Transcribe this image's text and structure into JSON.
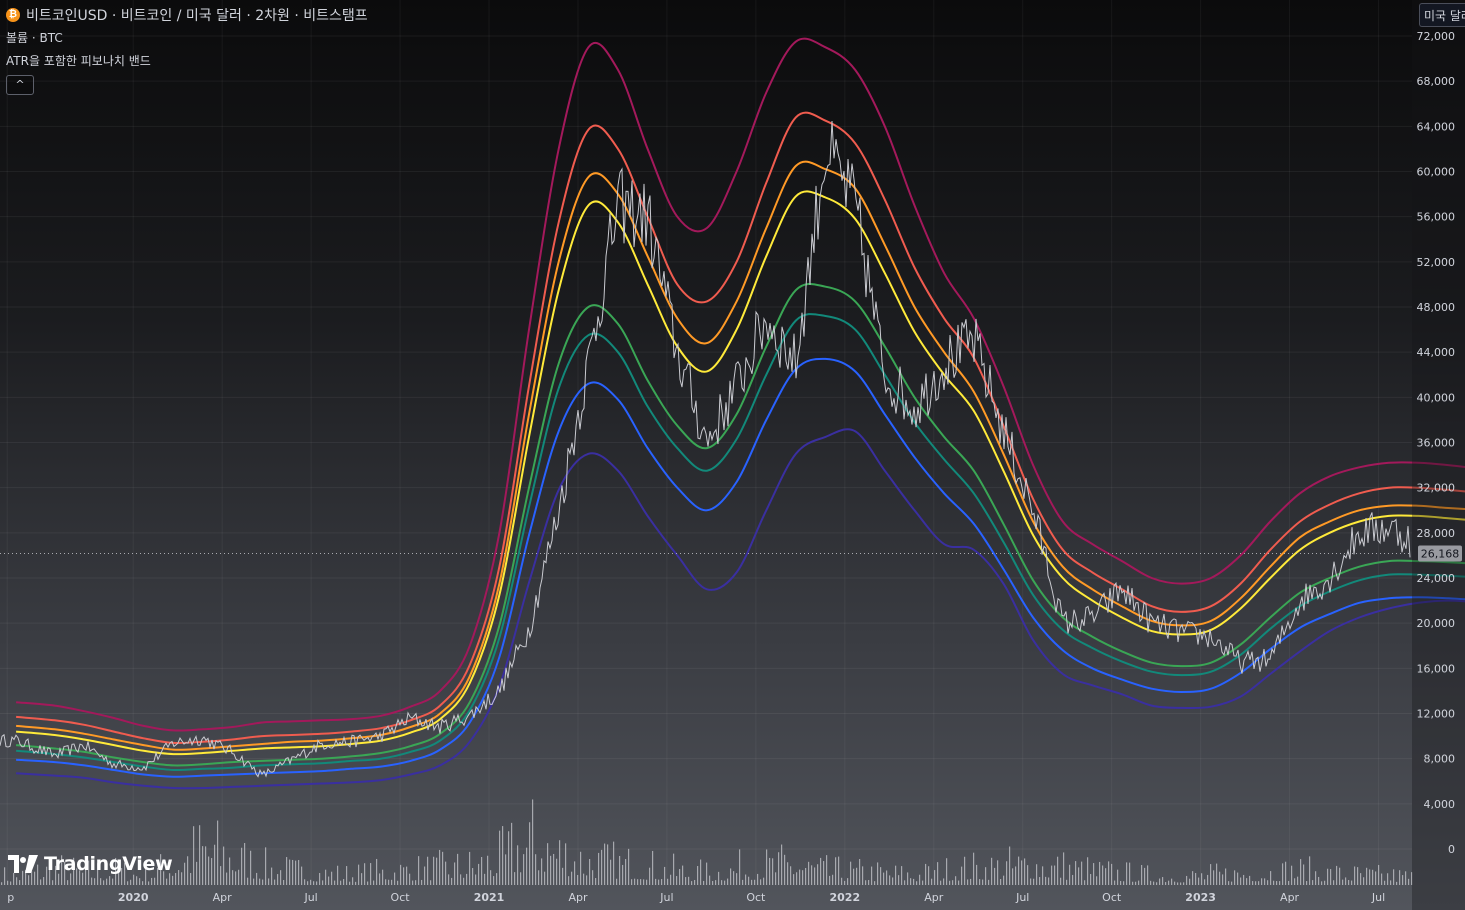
{
  "header": {
    "symbol_title": "비트코인USD · 비트코인 / 미국 달러 · 2차원 · 비트스탬프",
    "volume_label": "볼륨 · BTC",
    "indicator_label": "ATR을 포함한 피보나치 밴드",
    "collapse_icon": "chevron-up-icon"
  },
  "currency_button": {
    "label": "미국 달러"
  },
  "brand": {
    "name": "TradingView"
  },
  "colors": {
    "price": "#c9cad0",
    "volume": "#c5c7cc",
    "bands": [
      "#a3195b",
      "#f05c4f",
      "#ff9a26",
      "#ffea3a",
      "#3aa655",
      "#12897a",
      "#2962ff",
      "#3a2fa0"
    ]
  },
  "chart_data": {
    "type": "line",
    "x_ticks": [
      "p",
      "2020",
      "Apr",
      "Jul",
      "Oct",
      "2021",
      "Apr",
      "Jul",
      "Oct",
      "2022",
      "Apr",
      "Jul",
      "Oct",
      "2023",
      "Apr",
      "Jul"
    ],
    "y_ticks": [
      "72,000",
      "68,000",
      "64,000",
      "60,000",
      "56,000",
      "52,000",
      "48,000",
      "44,000",
      "40,000",
      "36,000",
      "32,000",
      "28,000",
      "24,000",
      "20,000",
      "16,000",
      "12,000",
      "8,000",
      "4,000",
      "0"
    ],
    "ylim": [
      0,
      72000
    ],
    "last_price": 26168,
    "last_price_label": "26,168",
    "x_months_from_sep_2019": [
      -0.3,
      1,
      2,
      3,
      4,
      5,
      6,
      7,
      8,
      9,
      10,
      11,
      12,
      13,
      14,
      15,
      16,
      17,
      18,
      19,
      20,
      21,
      22,
      23,
      24,
      25,
      26,
      27,
      28,
      29,
      30,
      31,
      32,
      33,
      34,
      35,
      36,
      37,
      38,
      39,
      40,
      41,
      42,
      43,
      44,
      45,
      46,
      47,
      48,
      49.3
    ],
    "series": [
      {
        "values": [
          9600,
          8300,
          9200,
          7500,
          7200,
          9400,
          9800,
          8600,
          6500,
          7900,
          9300,
          9500,
          10000,
          11600,
          10800,
          11800,
          14000,
          19500,
          30000,
          43000,
          57000,
          56000,
          44000,
          36000,
          41000,
          47000,
          43000,
          62000,
          57000,
          42000,
          39000,
          43000,
          45000,
          37000,
          30000,
          20000,
          20500,
          23000,
          20000,
          19200,
          18800,
          16500,
          16800,
          22000,
          24000,
          28000,
          28500,
          27000,
          30500,
          26168
        ]
      },
      {
        "values": [
          13000,
          12700,
          12200,
          11600,
          10900,
          10500,
          10600,
          10800,
          11200,
          11300,
          11400,
          11500,
          11800,
          12600,
          14000,
          18000,
          28000,
          46000,
          62000,
          71000,
          69000,
          62000,
          56000,
          55000,
          60000,
          67000,
          71500,
          71000,
          69000,
          64000,
          57000,
          51000,
          47000,
          41000,
          34000,
          29000,
          27000,
          25500,
          24000,
          23500,
          24000,
          26000,
          29000,
          31500,
          33000,
          33800,
          34200,
          34200,
          34000,
          33600
        ]
      },
      {
        "values": [
          11700,
          11400,
          11000,
          10400,
          9800,
          9400,
          9500,
          9700,
          10000,
          10100,
          10200,
          10400,
          10700,
          11400,
          12700,
          16300,
          25000,
          41000,
          55500,
          63700,
          62000,
          56000,
          50000,
          48500,
          52000,
          59000,
          64800,
          64500,
          62500,
          57500,
          51500,
          47000,
          43500,
          37500,
          31000,
          26500,
          24500,
          23000,
          21500,
          21000,
          21500,
          23500,
          26500,
          29000,
          30500,
          31500,
          32000,
          32000,
          31800,
          31500
        ]
      },
      {
        "values": [
          10900,
          10600,
          10200,
          9700,
          9200,
          8800,
          8900,
          9100,
          9300,
          9500,
          9600,
          9800,
          10100,
          10800,
          12000,
          15300,
          23500,
          38500,
          52000,
          59500,
          58000,
          52500,
          47000,
          44800,
          48500,
          55000,
          60500,
          60200,
          58500,
          53500,
          48000,
          44000,
          40500,
          35000,
          29000,
          25000,
          23000,
          21500,
          20200,
          19800,
          20200,
          22200,
          25000,
          27600,
          29000,
          30000,
          30400,
          30400,
          30200,
          30000
        ]
      },
      {
        "values": [
          10400,
          10100,
          9700,
          9200,
          8700,
          8400,
          8500,
          8700,
          8900,
          9000,
          9100,
          9300,
          9600,
          10300,
          11500,
          14700,
          22500,
          36500,
          49500,
          57000,
          55500,
          50000,
          44500,
          42300,
          46000,
          52500,
          57800,
          57700,
          55800,
          51000,
          45800,
          42000,
          38800,
          33500,
          27800,
          24000,
          22000,
          20500,
          19300,
          19000,
          19400,
          21300,
          24000,
          26500,
          28000,
          29000,
          29500,
          29500,
          29300,
          29000
        ]
      },
      {
        "values": [
          9200,
          8900,
          8600,
          8100,
          7700,
          7400,
          7500,
          7700,
          7800,
          7900,
          8000,
          8200,
          8500,
          9100,
          10200,
          13000,
          19800,
          32000,
          43000,
          48000,
          46500,
          41500,
          37500,
          35500,
          38500,
          44500,
          49500,
          49800,
          48500,
          44500,
          40000,
          36500,
          33500,
          28800,
          23800,
          20500,
          18800,
          17500,
          16500,
          16200,
          16500,
          18100,
          20500,
          22700,
          24000,
          25000,
          25500,
          25500,
          25400,
          25200
        ]
      },
      {
        "values": [
          8700,
          8400,
          8100,
          7700,
          7300,
          7000,
          7100,
          7200,
          7400,
          7500,
          7600,
          7800,
          8000,
          8600,
          9600,
          12300,
          18700,
          30300,
          40800,
          45500,
          44000,
          39200,
          35500,
          33500,
          36300,
          42000,
          46800,
          47200,
          46000,
          42000,
          37800,
          34500,
          31500,
          27200,
          22500,
          19400,
          17800,
          16600,
          15700,
          15400,
          15700,
          17200,
          19500,
          21500,
          22800,
          23800,
          24300,
          24300,
          24200,
          24000
        ]
      },
      {
        "values": [
          7900,
          7700,
          7400,
          7000,
          6600,
          6400,
          6500,
          6600,
          6700,
          6800,
          6900,
          7100,
          7300,
          7800,
          8800,
          11200,
          17000,
          27800,
          37000,
          41200,
          39800,
          35500,
          32000,
          30000,
          32500,
          38000,
          42500,
          43400,
          42300,
          38500,
          34700,
          31500,
          28800,
          24800,
          20500,
          17600,
          16000,
          15000,
          14200,
          13900,
          14200,
          15600,
          17700,
          19600,
          20800,
          21800,
          22200,
          22300,
          22200,
          22000
        ]
      },
      {
        "values": [
          6700,
          6500,
          6300,
          5900,
          5600,
          5400,
          5400,
          5500,
          5600,
          5700,
          5800,
          5900,
          6100,
          6600,
          7400,
          9500,
          14400,
          23600,
          31800,
          35000,
          33500,
          29500,
          26000,
          23000,
          24500,
          30000,
          35000,
          36500,
          37000,
          33500,
          30000,
          27000,
          26500,
          23500,
          18500,
          15500,
          14500,
          13700,
          12700,
          12500,
          12600,
          13500,
          15500,
          17500,
          19300,
          20500,
          21300,
          21800,
          22000,
          21800
        ]
      }
    ],
    "volume_values": [
      20,
      35,
      28,
      30,
      22,
      45,
      80,
      60,
      38,
      30,
      25,
      22,
      28,
      32,
      35,
      40,
      55,
      95,
      70,
      50,
      45,
      38,
      30,
      25,
      35,
      40,
      45,
      30,
      28,
      25,
      22,
      30,
      35,
      40,
      45,
      38,
      30,
      25,
      20,
      18,
      22,
      25,
      28,
      30,
      25,
      22,
      20,
      18,
      15,
      12
    ],
    "gridlines": true
  }
}
